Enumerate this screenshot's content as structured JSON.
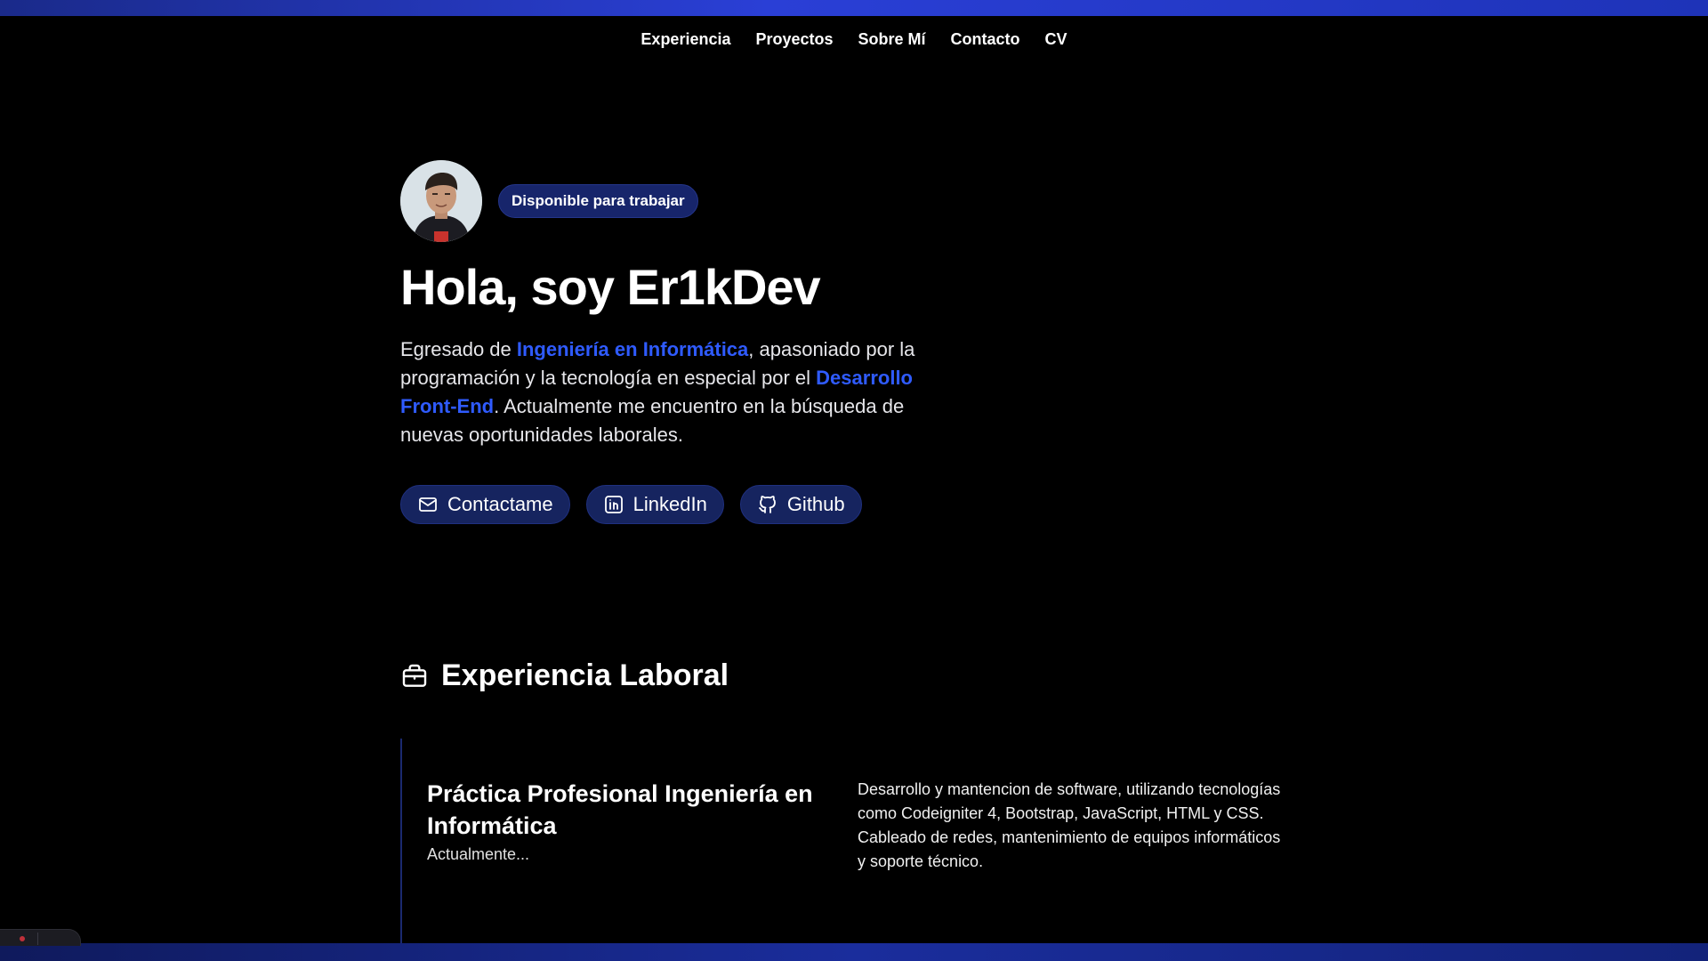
{
  "nav": {
    "items": [
      "Experiencia",
      "Proyectos",
      "Sobre Mí",
      "Contacto",
      "CV"
    ]
  },
  "hero": {
    "avatar_alt": "Foto de perfil",
    "badge": "Disponible para trabajar",
    "title": "Hola, soy Er1kDev",
    "intro": {
      "p1": "Egresado de ",
      "h1": "Ingeniería en Informática",
      "p2": ", apasoniado por la programación y la tecnología en especial por el ",
      "h2": "Desarrollo Front-End",
      "p3": ". Actualmente me encuentro en la búsqueda de nuevas oportunidades laborales."
    },
    "buttons": {
      "contact": "Contactame",
      "linkedin": "LinkedIn",
      "github": "Github"
    }
  },
  "experience": {
    "heading": "Experiencia Laboral",
    "jobs": [
      {
        "title": "Práctica Profesional Ingeniería en Informática",
        "date": "Actualmente...",
        "description": "Desarrollo y mantencion de software, utilizando tecnologías como Codeigniter 4, Bootstrap, JavaScript, HTML y CSS. Cableado de redes, mantenimiento de equipos informáticos y soporte técnico."
      }
    ]
  },
  "colors": {
    "background": "#000000",
    "accent": "#2f5bff",
    "button_bg": "#16245f",
    "top_bar": "#2a3fd6"
  }
}
